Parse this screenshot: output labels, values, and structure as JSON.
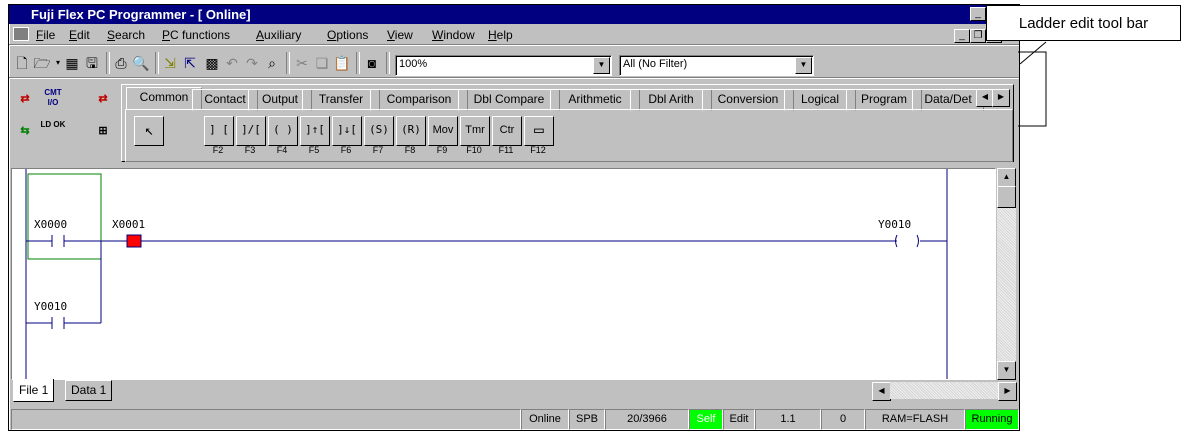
{
  "window": {
    "title": "Fuji Flex PC Programmer - [ Online]"
  },
  "annotation": {
    "callout": "Ladder edit tool bar"
  },
  "menu": {
    "items": [
      {
        "accel": "F",
        "rest": "ile"
      },
      {
        "accel": "E",
        "rest": "dit"
      },
      {
        "accel": "S",
        "rest": "earch"
      },
      {
        "accel": "P",
        "rest": "C functions"
      },
      {
        "accel": "A",
        "rest": "uxiliary"
      },
      {
        "accel": "O",
        "rest": "ptions"
      },
      {
        "accel": "V",
        "rest": "iew"
      },
      {
        "accel": "W",
        "rest": "indow"
      },
      {
        "accel": "H",
        "rest": "elp"
      }
    ]
  },
  "toolbar": {
    "zoom": "100%",
    "filter": "All (No Filter)"
  },
  "left_tools": {
    "btn1": "⇄",
    "btn2": "CMT I/O",
    "btn3": "⇄",
    "btn4": "⇆",
    "btn5": "LD OK",
    "btn6": "⊞"
  },
  "palette": {
    "tabs": [
      "Common",
      "Contact",
      "Output",
      "Transfer",
      "Comparison",
      "Dbl Compare",
      "Arithmetic",
      "Dbl Arith",
      "Conversion",
      "Logical",
      "Program",
      "Data/Det"
    ],
    "buttons": [
      {
        "glyph": "] [",
        "fkey": "F2"
      },
      {
        "glyph": "]/[",
        "fkey": "F3"
      },
      {
        "glyph": "( )",
        "fkey": "F4"
      },
      {
        "glyph": "]↑[",
        "fkey": "F5"
      },
      {
        "glyph": "]↓[",
        "fkey": "F6"
      },
      {
        "glyph": "(S)",
        "fkey": "F7"
      },
      {
        "glyph": "(R)",
        "fkey": "F8"
      },
      {
        "glyph": "Mov",
        "fkey": "F9"
      },
      {
        "glyph": "Tmr",
        "fkey": "F10"
      },
      {
        "glyph": "Ctr",
        "fkey": "F11"
      },
      {
        "glyph": "▭",
        "fkey": "F12"
      }
    ]
  },
  "ladder": {
    "contact1": "X0000",
    "contact2": "X0001",
    "coil": "Y0010",
    "contact3": "Y0010"
  },
  "file_tabs": [
    "File 1",
    "Data 1"
  ],
  "status": {
    "mode": "Online",
    "cpu": "SPB",
    "steps": "20/3966",
    "self": "Self",
    "edit": "Edit",
    "version": "1.1",
    "count": "0",
    "memory": "RAM=FLASH",
    "state": "Running"
  },
  "colors": {
    "title_bg": "#000080",
    "face": "#c0c0c0",
    "running": "#00ff00",
    "cursor": "#ff0000"
  }
}
